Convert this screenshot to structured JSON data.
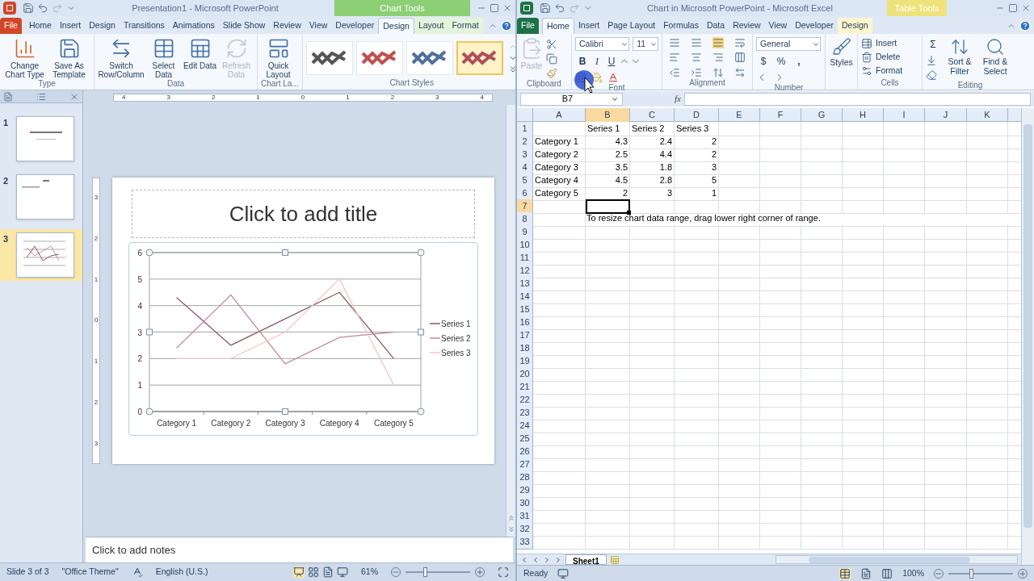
{
  "powerpoint": {
    "title": "Presentation1  -  Microsoft PowerPoint",
    "context_label": "Chart Tools",
    "tabs": [
      {
        "label": "File",
        "kind": "file",
        "selected": false
      },
      {
        "label": "Home",
        "kind": "tab",
        "selected": false
      },
      {
        "label": "Insert",
        "kind": "tab",
        "selected": false
      },
      {
        "label": "Design",
        "kind": "tab",
        "selected": false
      },
      {
        "label": "Transitions",
        "kind": "tab",
        "selected": false
      },
      {
        "label": "Animations",
        "kind": "tab",
        "selected": false
      },
      {
        "label": "Slide Show",
        "kind": "tab",
        "selected": false
      },
      {
        "label": "Review",
        "kind": "tab",
        "selected": false
      },
      {
        "label": "View",
        "kind": "tab",
        "selected": false
      },
      {
        "label": "Developer",
        "kind": "tab",
        "selected": false
      },
      {
        "label": "Design",
        "kind": "context",
        "selected": true
      },
      {
        "label": "Layout",
        "kind": "context",
        "selected": false
      },
      {
        "label": "Format",
        "kind": "context",
        "selected": false
      }
    ],
    "ribbon_groups": [
      {
        "label": "Type",
        "buttons": [
          {
            "label": "Change Chart Type",
            "kind": "chart",
            "disabled": false
          },
          {
            "label": "Save As Template",
            "kind": "template",
            "disabled": false
          }
        ]
      },
      {
        "label": "Data",
        "buttons": [
          {
            "label": "Switch Row/Column",
            "kind": "switch",
            "disabled": false
          },
          {
            "label": "Select Data",
            "kind": "select",
            "disabled": false
          },
          {
            "label": "Edit Data",
            "kind": "edit",
            "disabled": false
          },
          {
            "label": "Refresh Data",
            "kind": "refresh",
            "disabled": true
          }
        ]
      },
      {
        "label": "Chart La...",
        "buttons": [
          {
            "label": "Quick Layout",
            "kind": "layout",
            "disabled": false
          }
        ]
      }
    ],
    "chart_styles": {
      "label": "Chart Styles",
      "items": [
        {
          "selected": false,
          "color": "#555555"
        },
        {
          "selected": false,
          "color": "#c0504d"
        },
        {
          "selected": false,
          "color": "#4f6fa0"
        },
        {
          "selected": true,
          "color": "#b0505a"
        }
      ]
    },
    "ruler": {
      "horizontal": [
        "4",
        "3",
        "2",
        "1",
        "0",
        "1",
        "2",
        "3",
        "4"
      ],
      "vertical": [
        "3",
        "2",
        "1",
        "0",
        "1",
        "2",
        "3"
      ]
    },
    "slides": [
      {
        "number": "1",
        "kind": "title",
        "selected": false
      },
      {
        "number": "2",
        "kind": "text",
        "selected": false
      },
      {
        "number": "3",
        "kind": "chart",
        "selected": true
      }
    ],
    "slide": {
      "title_placeholder": "Click to add title",
      "chart_data": {
        "type": "line",
        "grid": true,
        "legend": "right",
        "categories": [
          "Category 1",
          "Category 2",
          "Category 3",
          "Category 4",
          "Category 5"
        ],
        "ylim": [
          0,
          6
        ],
        "yticks": [
          0,
          1,
          2,
          3,
          4,
          5,
          6
        ],
        "series": [
          {
            "name": "Series 1",
            "color": "#8c5a62",
            "values": [
              4.3,
              2.5,
              3.5,
              4.5,
              2
            ]
          },
          {
            "name": "Series 2",
            "color": "#c28f95",
            "values": [
              2.4,
              4.4,
              1.8,
              2.8,
              3
            ]
          },
          {
            "name": "Series 3",
            "color": "#ecc9cb",
            "values": [
              2,
              2,
              3,
              5,
              1
            ]
          }
        ]
      }
    },
    "notes_placeholder": "Click to add notes",
    "status_bar": {
      "slide": "Slide 3 of 3",
      "theme": "\"Office Theme\"",
      "language": "English (U.S.)",
      "zoom": "61%",
      "level": 0.31
    }
  },
  "excel": {
    "title": "Chart in Microsoft PowerPoint  -  Microsoft Excel",
    "context_label": "Table Tools",
    "tabs": [
      {
        "label": "File",
        "kind": "file",
        "selected": false
      },
      {
        "label": "Home",
        "kind": "tab",
        "selected": true
      },
      {
        "label": "Insert",
        "kind": "tab",
        "selected": false
      },
      {
        "label": "Page Layout",
        "kind": "tab",
        "selected": false
      },
      {
        "label": "Formulas",
        "kind": "tab",
        "selected": false
      },
      {
        "label": "Data",
        "kind": "tab",
        "selected": false
      },
      {
        "label": "Review",
        "kind": "tab",
        "selected": false
      },
      {
        "label": "View",
        "kind": "tab",
        "selected": false
      },
      {
        "label": "Developer",
        "kind": "tab",
        "selected": false
      },
      {
        "label": "Design",
        "kind": "context",
        "selected": false
      }
    ],
    "ribbon": {
      "clipboard": {
        "label": "Clipboard",
        "paste": "Paste",
        "paste_disabled": true
      },
      "font": {
        "label": "Font",
        "name": "Calibri",
        "size": "11",
        "bold": "B",
        "italic": "I",
        "underline": "U"
      },
      "alignment": {
        "label": "Alignment"
      },
      "number": {
        "label": "Number",
        "format": "General",
        "currency": "$",
        "percent": "%",
        "comma": ","
      },
      "styles": {
        "button": "Styles"
      },
      "cells": {
        "label": "Cells",
        "buttons": [
          "Insert",
          "Delete",
          "Format"
        ]
      },
      "editing": {
        "label": "Editing",
        "sum": "Σ",
        "buttons": [
          "Sort & Filter",
          "Find & Select"
        ]
      }
    },
    "name_box": "B7",
    "function_label": "fx",
    "columns": [
      {
        "label": "A",
        "selected": false
      },
      {
        "label": "B",
        "selected": true
      },
      {
        "label": "C",
        "selected": false
      },
      {
        "label": "D",
        "selected": false
      },
      {
        "label": "E",
        "selected": false
      },
      {
        "label": "F",
        "selected": false
      },
      {
        "label": "G",
        "selected": false
      },
      {
        "label": "H",
        "selected": false
      },
      {
        "label": "I",
        "selected": false
      },
      {
        "label": "J",
        "selected": false
      },
      {
        "label": "K",
        "selected": false
      }
    ],
    "rows": [
      {
        "number": "1",
        "selected": false,
        "headers": [
          "Series 1",
          "Series 2",
          "Series 3"
        ]
      },
      {
        "number": "2",
        "selected": false,
        "label": "Category 1",
        "values": [
          "4.3",
          "2.4",
          "2"
        ]
      },
      {
        "number": "3",
        "selected": false,
        "label": "Category 2",
        "values": [
          "2.5",
          "4.4",
          "2"
        ]
      },
      {
        "number": "4",
        "selected": false,
        "label": "Category 3",
        "values": [
          "3.5",
          "1.8",
          "3"
        ]
      },
      {
        "number": "5",
        "selected": false,
        "label": "Category 4",
        "values": [
          "4.5",
          "2.8",
          "5"
        ]
      },
      {
        "number": "6",
        "selected": false,
        "label": "Category 5",
        "values": [
          "2",
          "3",
          "1"
        ]
      },
      {
        "number": "7",
        "selected": true
      },
      {
        "number": "8",
        "selected": false,
        "note": "To resize chart data range, drag lower right corner of range."
      },
      {
        "number": "9",
        "selected": false
      },
      {
        "number": "10",
        "selected": false
      },
      {
        "number": "11",
        "selected": false
      },
      {
        "number": "12",
        "selected": false
      },
      {
        "number": "13",
        "selected": false
      },
      {
        "number": "14",
        "selected": false
      },
      {
        "number": "15",
        "selected": false
      },
      {
        "number": "16",
        "selected": false
      },
      {
        "number": "17",
        "selected": false
      },
      {
        "number": "18",
        "selected": false
      },
      {
        "number": "19",
        "selected": false
      },
      {
        "number": "20",
        "selected": false
      },
      {
        "number": "21",
        "selected": false
      },
      {
        "number": "22",
        "selected": false
      },
      {
        "number": "23",
        "selected": false
      },
      {
        "number": "24",
        "selected": false
      },
      {
        "number": "25",
        "selected": false
      },
      {
        "number": "26",
        "selected": false
      },
      {
        "number": "27",
        "selected": false
      },
      {
        "number": "28",
        "selected": false
      },
      {
        "number": "29",
        "selected": false
      },
      {
        "number": "30",
        "selected": false
      },
      {
        "number": "31",
        "selected": false
      },
      {
        "number": "32",
        "selected": false
      },
      {
        "number": "33",
        "selected": false
      }
    ],
    "sheet_tabs": [
      {
        "label": "Sheet1",
        "selected": true
      }
    ],
    "status_bar": {
      "mode": "Ready",
      "zoom": "100%",
      "level": 0.35
    }
  }
}
